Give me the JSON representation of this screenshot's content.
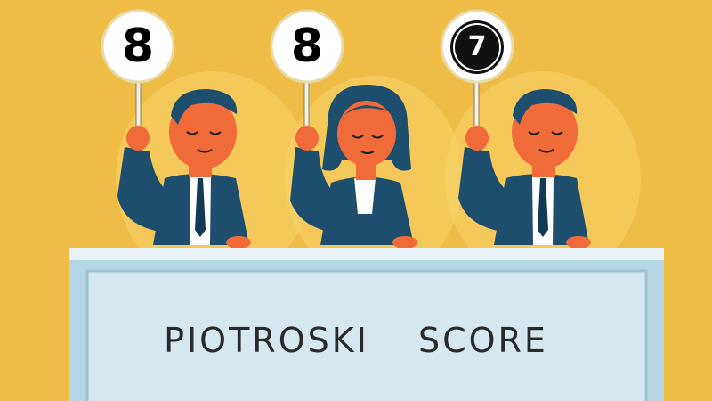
{
  "scores": {
    "judge_left": "8",
    "judge_middle": "8",
    "judge_right": "7"
  },
  "desk": {
    "title": "PIOTROSKI SCORE"
  },
  "colors": {
    "background": "#efbd45",
    "suit": "#1e4e6e",
    "skin": "#f06a3a",
    "desk_panel": "#d6e7ef",
    "desk_frame": "#b5d6e3"
  }
}
